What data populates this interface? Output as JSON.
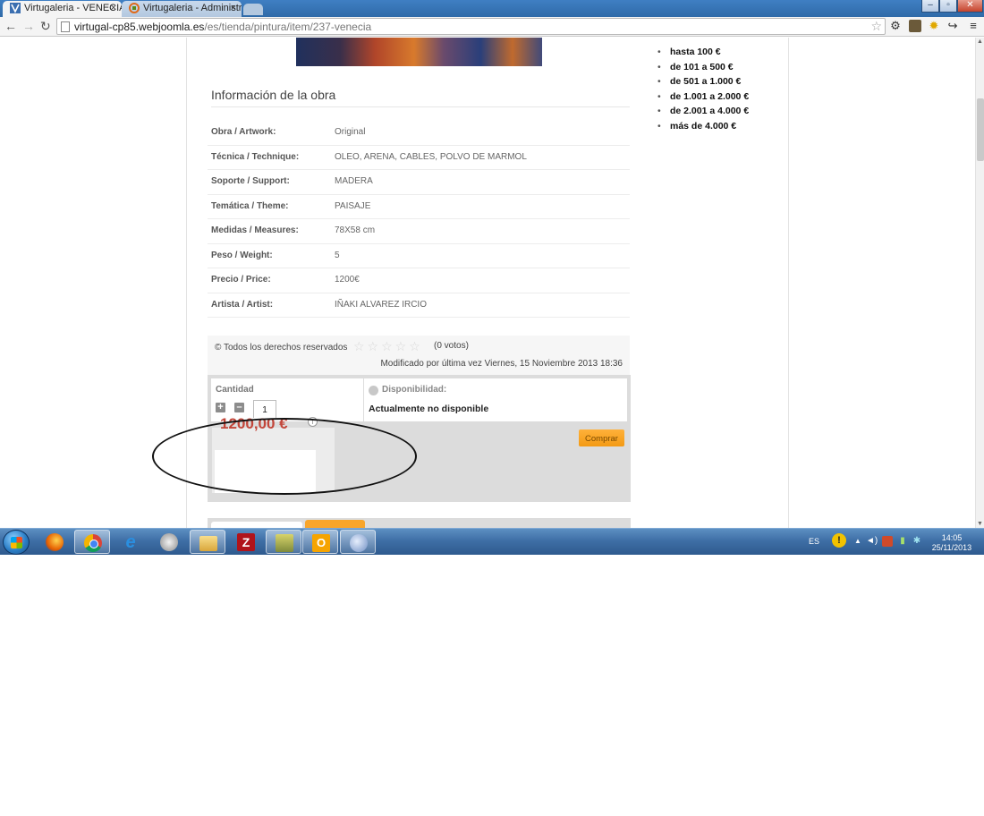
{
  "browser": {
    "tabs": [
      {
        "title": "Virtugaleria - VENECIA",
        "active": true
      },
      {
        "title": "Virtugaleria - Administració",
        "active": false
      }
    ],
    "tab_close_glyph": "×",
    "window_controls": {
      "minimize": "–",
      "maximize": "▫",
      "close": "✕"
    },
    "url_host": "virtugal-cp85.webjoomla.es",
    "url_path": "/es/tienda/pintura/item/237-venecia",
    "icons": {
      "back": "←",
      "forward": "→",
      "reload": "↻",
      "star": "☆",
      "gear": "⚙",
      "sun": "✹",
      "arrow": "↪",
      "menu": "≡"
    }
  },
  "sidebar_filters": [
    "hasta 100 €",
    "de 101 a 500 €",
    "de 501 a 1.000 €",
    "de 1.001 a 2.000 €",
    "de 2.001 a 4.000 €",
    "más de 4.000 €"
  ],
  "filter_bullet": "•",
  "info": {
    "title": "Información de la obra",
    "rows": [
      {
        "label": "Obra / Artwork:",
        "value": "Original"
      },
      {
        "label": "Técnica / Technique:",
        "value": "OLEO, ARENA, CABLES, POLVO DE MARMOL"
      },
      {
        "label": "Soporte / Support:",
        "value": "MADERA"
      },
      {
        "label": "Temática / Theme:",
        "value": "PAISAJE"
      },
      {
        "label": "Medidas / Measures:",
        "value": "78X58 cm"
      },
      {
        "label": "Peso / Weight:",
        "value": "5"
      },
      {
        "label": "Precio / Price:",
        "value": "1200€"
      },
      {
        "label": "Artista / Artist:",
        "value": "IÑAKI ALVAREZ IRCIO"
      }
    ]
  },
  "meta": {
    "rights": "© Todos los derechos reservados",
    "stars": "☆☆☆☆☆",
    "rating_value": 0,
    "votes": "(0 votos)",
    "modified": "Modificado por última vez Viernes, 15 Noviembre 2013 18:36"
  },
  "cart": {
    "quantity_label": "Cantidad",
    "quantity_value": "1",
    "plus_glyph": "+",
    "minus_glyph": "–",
    "availability_label": "Disponibilidad:",
    "availability_status": "Actualmente no disponible",
    "buy_label": "Comprar",
    "price": "1200,00 €",
    "info_glyph": "i"
  },
  "taskbar": {
    "apps": [
      "firefox",
      "chrome",
      "internet-explorer",
      "hp",
      "explorer",
      "filezilla",
      "file-manager",
      "outlook",
      "paint"
    ],
    "ie_glyph": "e",
    "filezilla_glyph": "Z",
    "outlook_glyph": "O",
    "tray": {
      "language": "ES",
      "alert_glyph": "!",
      "arrow_glyph": "▲",
      "volume_glyph": "◄)",
      "time": "14:05",
      "date": "25/11/2013"
    }
  }
}
